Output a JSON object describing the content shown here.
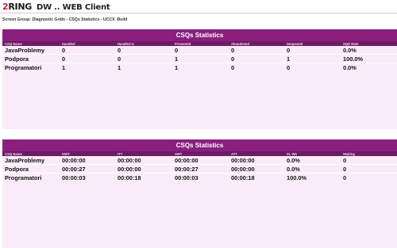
{
  "header": {
    "logo_two": "2",
    "logo_rest": "RING",
    "app_title": "DW .. WEB Client"
  },
  "screen_group": "Screen Group: Diagnostic Grids - CSQs Statistics - UCCX_Build",
  "panel1": {
    "title": "CSQs Statistics",
    "columns": [
      "CSQ Name",
      "Handled",
      "Handled Ic",
      "Presented",
      "Abandoned",
      "Dequeued",
      "SQD Rate"
    ],
    "rows": [
      [
        "JavaProblemy",
        "0",
        "0",
        "0",
        "0",
        "0",
        "0.0%"
      ],
      [
        "Podpora",
        "0",
        "0",
        "1",
        "0",
        "1",
        "100.0%"
      ],
      [
        "Programatori",
        "1",
        "1",
        "1",
        "0",
        "0",
        "0.0%"
      ]
    ]
  },
  "panel2": {
    "title": "CSQs Statistics",
    "columns": [
      "CSQ Name",
      "OWT",
      "ITT",
      "AWT",
      "ATT",
      "SL WA",
      "Waiting"
    ],
    "rows": [
      [
        "JavaProblemy",
        "00:00:00",
        "00:00:00",
        "00:00:00",
        "00:00:00",
        "0.0%",
        "0"
      ],
      [
        "Podpora",
        "00:00:27",
        "00:00:00",
        "00:00:27",
        "00:00:00",
        "0.0%",
        "0"
      ],
      [
        "Programatori",
        "00:00:03",
        "00:00:18",
        "00:00:03",
        "00:00:18",
        "100.0%",
        "0"
      ]
    ]
  },
  "colors": {
    "title_bar": "#8a1f7e",
    "column_header": "#6e1a66",
    "panel_bg": "#f9ecf8"
  }
}
